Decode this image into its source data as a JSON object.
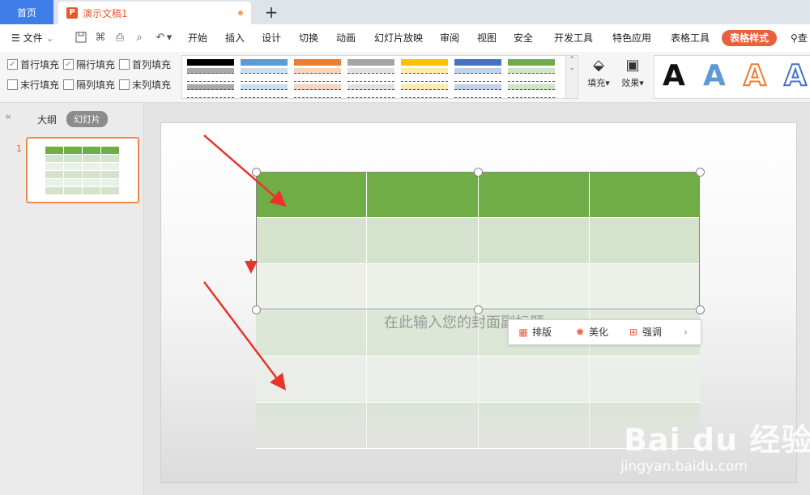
{
  "tabs": {
    "home": "首页",
    "document": "演示文稿1",
    "add": "+"
  },
  "menu": {
    "file": "文件",
    "items": [
      "开始",
      "插入",
      "设计",
      "切换",
      "动画",
      "幻灯片放映",
      "审阅",
      "视图",
      "安全",
      "开发工具",
      "特色应用",
      "表格工具"
    ],
    "active": "表格样式",
    "search_partial": "查"
  },
  "ribbon": {
    "checkboxes": [
      {
        "label": "首行填充",
        "checked": true
      },
      {
        "label": "隔行填充",
        "checked": true
      },
      {
        "label": "首列填充",
        "checked": false
      },
      {
        "label": "末行填充",
        "checked": false
      },
      {
        "label": "隔列填充",
        "checked": false
      },
      {
        "label": "末列填充",
        "checked": false
      }
    ],
    "style_colors": [
      "#000000",
      "#5b9bd5",
      "#ed7d31",
      "#a5a5a5",
      "#ffc000",
      "#4472c4",
      "#70ad47"
    ],
    "fill_label": "填充",
    "effect_label": "效果",
    "text_styles": [
      {
        "glyph": "A",
        "color": "#111111"
      },
      {
        "glyph": "A",
        "color": "#5b9bd5"
      },
      {
        "glyph": "A",
        "color": "#ed7d31"
      },
      {
        "glyph": "A",
        "color": "#4472c4"
      }
    ]
  },
  "left_panel": {
    "outline": "大纲",
    "slides": "幻灯片",
    "slide_number": "1"
  },
  "slide": {
    "placeholder": "在此输入您的封面副标题",
    "table": {
      "columns": 4,
      "rows": 6,
      "header_color": "#70ad47",
      "band1": "#d5e3cd",
      "band2": "#ebf0e8"
    }
  },
  "float_toolbar": {
    "layout": "排版",
    "beautify": "美化",
    "emphasize": "强调"
  },
  "watermark": {
    "main": "Bai du 经验",
    "sub": "jingyan.baidu.com"
  }
}
